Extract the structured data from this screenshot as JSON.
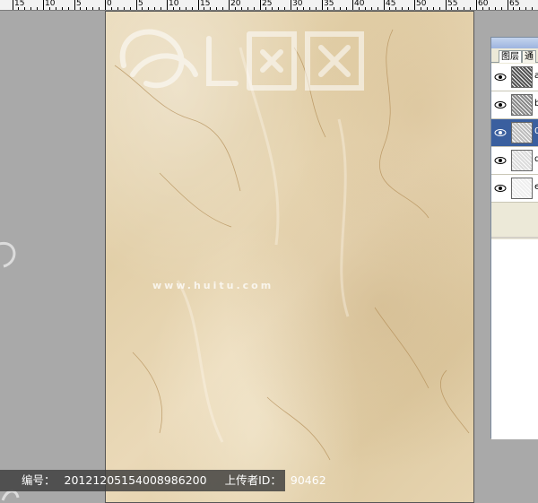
{
  "ruler": {
    "labels": [
      "15",
      "10",
      "5",
      "0",
      "5",
      "10",
      "15",
      "20",
      "25",
      "30",
      "35",
      "40",
      "45",
      "50",
      "55",
      "60",
      "65"
    ]
  },
  "watermark": {
    "brand": "汇图网",
    "url": "www.huitu.com"
  },
  "caption": {
    "id_label": "编号：",
    "id_value": "20121205154008986200",
    "uploader_label": "上传者ID：",
    "uploader_value": "90462"
  },
  "panel": {
    "tabs": [
      "图层",
      "通"
    ],
    "layers": [
      {
        "name": "a",
        "selected": false,
        "thumb": "#555"
      },
      {
        "name": "b",
        "selected": false,
        "thumb": "#8a8a8a"
      },
      {
        "name": "0",
        "selected": true,
        "thumb": "#bdbdbd"
      },
      {
        "name": "d",
        "selected": false,
        "thumb": "#dcdcdc"
      },
      {
        "name": "e",
        "selected": false,
        "thumb": "#efefef"
      }
    ]
  },
  "colors": {
    "workspace": "#a9a9a9",
    "marble": "#e6d4b0",
    "selection": "#3a5f9f"
  }
}
